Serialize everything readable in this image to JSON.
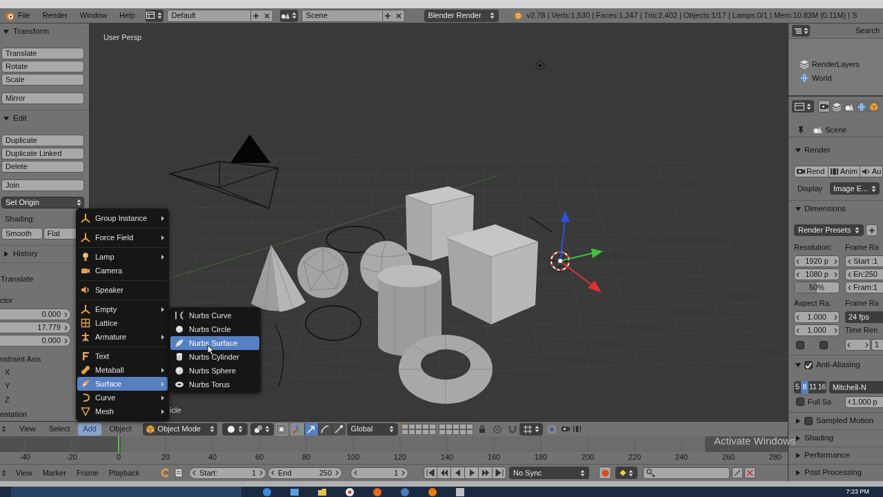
{
  "header": {
    "menus": [
      "File",
      "Render",
      "Window",
      "Help"
    ],
    "screen_layout": "Default",
    "scene": "Scene",
    "render_engine": "Blender Render",
    "stats": "v2.78 | Verts:1,530 | Faces:1,247 | Tris:2,402 | Objects:1/17 | Lamps:0/1 | Mem:10.83M (0.11M) | S"
  },
  "tool_shelf": {
    "panels": [
      {
        "title": "Transform",
        "expanded": true,
        "groups": [
          [
            "Translate",
            "Rotate",
            "Scale"
          ],
          [
            "Mirror"
          ]
        ]
      },
      {
        "title": "Edit",
        "expanded": true,
        "groups": [
          [
            "Duplicate",
            "Duplicate Linked",
            "Delete"
          ],
          [
            "Join"
          ]
        ],
        "dropdown": "Set Origin",
        "shading": {
          "label": "Shading:",
          "options": [
            "Smooth",
            "Flat"
          ]
        }
      },
      {
        "title": "History",
        "expanded": false
      }
    ],
    "operator": {
      "title": "Translate",
      "vector_label": "ctor",
      "vector": [
        "0.000",
        "17.779",
        "0.000"
      ],
      "constraint_label": "nstraint Axis",
      "axes": [
        "X",
        "Y",
        "Z"
      ],
      "orientation_label": "entation"
    }
  },
  "viewport": {
    "view_label": "User Persp",
    "last_operator": "icle"
  },
  "add_menu": {
    "groups": [
      [
        {
          "label": "Group Instance",
          "submenu": true,
          "selected": false
        }
      ],
      [
        {
          "label": "Force Field",
          "submenu": true,
          "selected": false
        }
      ],
      [
        {
          "label": "Lamp",
          "submenu": true,
          "selected": false
        },
        {
          "label": "Camera",
          "submenu": false,
          "selected": false
        }
      ],
      [
        {
          "label": "Speaker",
          "submenu": false,
          "selected": false
        }
      ],
      [
        {
          "label": "Empty",
          "submenu": true,
          "selected": false
        },
        {
          "label": "Lattice",
          "submenu": false,
          "selected": false
        },
        {
          "label": "Armature",
          "submenu": true,
          "selected": false
        }
      ],
      [
        {
          "label": "Text",
          "submenu": false,
          "selected": false
        },
        {
          "label": "Metaball",
          "submenu": true,
          "selected": false
        },
        {
          "label": "Surface",
          "submenu": true,
          "selected": true
        },
        {
          "label": "Curve",
          "submenu": true,
          "selected": false
        },
        {
          "label": "Mesh",
          "submenu": true,
          "selected": false
        }
      ]
    ]
  },
  "surface_submenu": {
    "items": [
      {
        "label": "Nurbs Curve",
        "selected": false
      },
      {
        "label": "Nurbs Circle",
        "selected": false
      },
      {
        "label": "Nurbs Surface",
        "selected": true
      },
      {
        "label": "Nurbs Cylinder",
        "selected": false
      },
      {
        "label": "Nurbs Sphere",
        "selected": false
      },
      {
        "label": "Nurbs Torus",
        "selected": false
      }
    ]
  },
  "view3d_header": {
    "menus": [
      {
        "label": "View",
        "selected": false
      },
      {
        "label": "Select",
        "selected": false
      },
      {
        "label": "Add",
        "selected": true
      },
      {
        "label": "Object",
        "selected": false
      }
    ],
    "mode": "Object Mode",
    "manipulator": {
      "on": true
    },
    "transform_tools": [
      {
        "selected": true
      },
      {
        "selected": false
      },
      {
        "selected": false
      }
    ],
    "orientation": "Global"
  },
  "timeline": {
    "ruler": [
      "-40",
      "-20",
      "0",
      "20",
      "40",
      "60",
      "80",
      "100",
      "120",
      "140",
      "160",
      "180",
      "200",
      "220",
      "240",
      "260",
      "280"
    ],
    "menus": [
      "View",
      "Marker",
      "Frame",
      "Playback"
    ],
    "start": {
      "label": "Start:",
      "value": "1"
    },
    "end": {
      "label": "End",
      "value": "250"
    },
    "current_frame": "1",
    "sync": "No Sync"
  },
  "properties": {
    "outliner": {
      "menu": "Search",
      "items": [
        {
          "label": "RenderLayers"
        },
        {
          "label": "World"
        }
      ]
    },
    "tabs": [
      {
        "selected": true
      },
      {
        "selected": false
      },
      {
        "selected": false
      },
      {
        "selected": false
      },
      {
        "selected": false
      }
    ],
    "context": "Scene",
    "panels": [
      {
        "kind": "render",
        "title": "Render",
        "expanded": true,
        "buttons": [
          "Rend",
          "Anim",
          "Au"
        ],
        "display": {
          "label": "Display",
          "value": "Image E..."
        }
      },
      {
        "kind": "dimensions",
        "title": "Dimensions",
        "expanded": true,
        "presets": "Render Presets",
        "resolution": {
          "label": "Resolution:",
          "fields": [
            "1920 p",
            "1080 p"
          ],
          "percentage": {
            "value": "50%",
            "level": 0.5
          }
        },
        "frame_range": {
          "label": "Frame Ra",
          "fields": [
            "Start :1",
            "En:250",
            "Fram:1"
          ]
        },
        "aspect": {
          "label": "Aspect Ra.",
          "fields": [
            "1.000",
            "1.000"
          ],
          "checkboxes": [
            {
              "checked": false
            },
            {
              "checked": false
            }
          ]
        },
        "frame_rate": {
          "label": "Frame Ra",
          "value": "24 fps"
        },
        "time_remap": {
          "label": "Time Ren",
          "value": "1"
        }
      },
      {
        "kind": "antialiasing",
        "title": "Anti-Aliasing",
        "expanded": true,
        "enabled": true,
        "samples": [
          {
            "label": "5",
            "selected": false
          },
          {
            "label": "8",
            "selected": true
          },
          {
            "label": "11",
            "selected": false
          },
          {
            "label": "16",
            "selected": false
          }
        ],
        "filter": "Mitchell-N",
        "full_sample": {
          "label": "Full Sa",
          "checked": false
        },
        "filter_size": "1.000 p"
      },
      {
        "kind": "plain",
        "title": "Sampled Motion",
        "expanded": false,
        "enabled": false
      },
      {
        "kind": "plain",
        "title": "Shading",
        "expanded": false
      },
      {
        "kind": "plain",
        "title": "Performance",
        "expanded": false
      },
      {
        "kind": "plain",
        "title": "Post Processing",
        "expanded": false
      }
    ]
  },
  "os_overlay": "Activate Windows",
  "taskbar": {
    "clock": "7:23 PM"
  }
}
